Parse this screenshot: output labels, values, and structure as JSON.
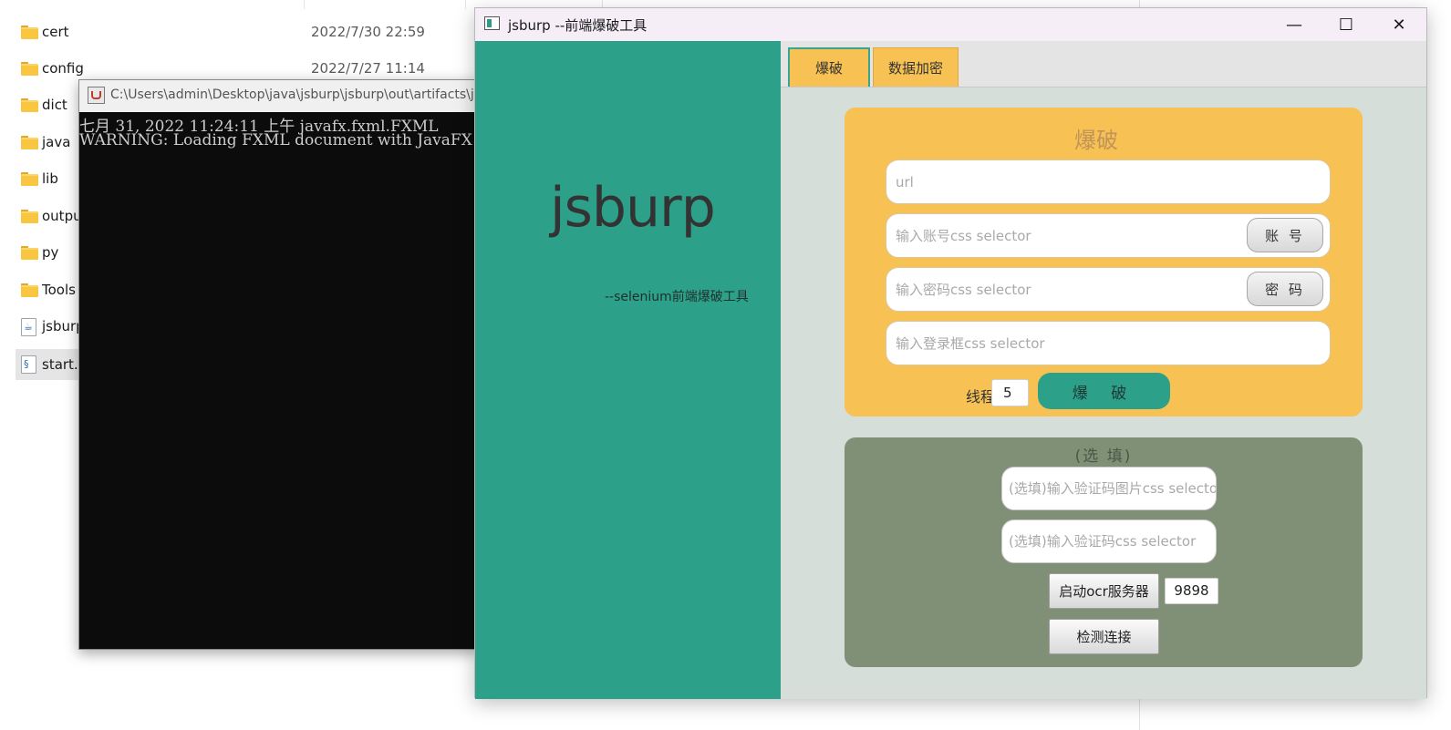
{
  "explorer": {
    "files": [
      {
        "name": "cert",
        "date": "2022/7/30 22:59",
        "icon": "folder-icon"
      },
      {
        "name": "config",
        "date": "2022/7/27 11:14",
        "icon": "folder-icon"
      },
      {
        "name": "dict",
        "date": "",
        "icon": "folder-icon"
      },
      {
        "name": "java",
        "date": "",
        "icon": "folder-icon"
      },
      {
        "name": "lib",
        "date": "",
        "icon": "folder-icon"
      },
      {
        "name": "outpu",
        "date": "",
        "icon": "folder-icon"
      },
      {
        "name": "py",
        "date": "",
        "icon": "folder-icon"
      },
      {
        "name": "Tools",
        "date": "",
        "icon": "folder-icon"
      },
      {
        "name": "jsburp",
        "date": "",
        "icon": "jar-file-icon"
      },
      {
        "name": "start.v",
        "date": "",
        "icon": "script-file-icon"
      }
    ]
  },
  "console": {
    "title": "C:\\Users\\admin\\Desktop\\java\\jsburp\\jsburp\\out\\artifacts\\jsbu",
    "lines": [
      "七月 31, 2022 11:24:11 上午 javafx.fxml.FXML",
      "WARNING: Loading FXML document with JavaFX A"
    ]
  },
  "app": {
    "title": "jsburp  --前端爆破工具",
    "window_controls": {
      "minimize": "—",
      "maximize": "☐",
      "close": "✕"
    },
    "brand": "jsburp",
    "brand_sub": "--selenium前端爆破工具",
    "tabs": [
      {
        "label": "爆破",
        "active": true
      },
      {
        "label": "数据加密",
        "active": false
      }
    ],
    "crack": {
      "title": "爆破",
      "url_placeholder": "url",
      "user_placeholder": "输入账号css selector",
      "user_button": "账 号",
      "pass_placeholder": "输入密码css selector",
      "pass_button": "密 码",
      "login_placeholder": "输入登录框css selector",
      "thread_label": "线程",
      "thread_value": "5",
      "crack_button": "爆 破"
    },
    "optional": {
      "title": "(选 填)",
      "captcha_img_placeholder": "(选填)输入验证码图片css selector",
      "captcha_placeholder": "(选填)输入验证码css selector",
      "ocr_button": "启动ocr服务器",
      "port_value": "9898",
      "check_button": "检测连接"
    },
    "colors": {
      "primary": "#2da08a",
      "accent": "#f7c253",
      "optional_bg": "#7f9077"
    }
  }
}
